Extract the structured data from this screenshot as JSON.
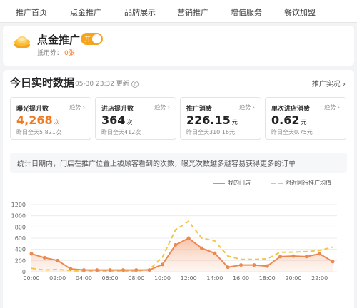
{
  "nav": {
    "items": [
      "推广首页",
      "点金推广",
      "品牌展示",
      "营销推广",
      "增值服务",
      "餐饮加盟"
    ]
  },
  "promo": {
    "title": "点金推广",
    "toggle_label": "开",
    "coupon_label": "抵用券：",
    "coupon_value": "0张"
  },
  "realtime": {
    "title": "今日实时数据",
    "update_time": "05-30 23:32 更新",
    "link": "推广实况 ›"
  },
  "metrics": [
    {
      "label": "曝光提升数",
      "trend": "趋势 ›",
      "value": "4,268",
      "unit": "次",
      "prev": "昨日全天5,821次",
      "highlight": true
    },
    {
      "label": "进店提升数",
      "trend": "趋势 ›",
      "value": "364",
      "unit": "次",
      "prev": "昨日全天412次",
      "highlight": false
    },
    {
      "label": "推广消费",
      "trend": "趋势 ›",
      "value": "226.15",
      "unit": "元",
      "prev": "昨日全天310.16元",
      "highlight": false
    },
    {
      "label": "单次进店消费",
      "trend": "趋势 ›",
      "value": "0.62",
      "unit": "元",
      "prev": "昨日全天0.75元",
      "highlight": false
    }
  ],
  "note": "统计日期内，门店在推广位置上被顾客看到的次数，曝光次数越多越容易获得更多的订单",
  "colors": {
    "accent": "#f07a22",
    "mine": "#ea8a52",
    "avg": "#f6c548"
  },
  "chart_data": {
    "type": "line",
    "x": [
      "00:00",
      "01:00",
      "02:00",
      "03:00",
      "04:00",
      "05:00",
      "06:00",
      "07:00",
      "08:00",
      "09:00",
      "10:00",
      "11:00",
      "12:00",
      "13:00",
      "14:00",
      "15:00",
      "16:00",
      "17:00",
      "18:00",
      "19:00",
      "20:00",
      "21:00",
      "22:00",
      "23:00"
    ],
    "xticks": [
      "00:00",
      "02:00",
      "04:00",
      "06:00",
      "08:00",
      "10:00",
      "12:00",
      "14:00",
      "16:00",
      "18:00",
      "20:00",
      "22:00"
    ],
    "yticks": [
      0,
      200,
      400,
      600,
      800,
      1000,
      1200
    ],
    "ylim": [
      0,
      1200
    ],
    "legend_position": "top-right",
    "series": [
      {
        "name": "我的门店",
        "values": [
          320,
          250,
          200,
          50,
          30,
          30,
          30,
          30,
          30,
          30,
          130,
          480,
          600,
          420,
          330,
          80,
          120,
          120,
          100,
          270,
          280,
          270,
          320,
          180
        ]
      },
      {
        "name": "附近同行推广均值",
        "values": [
          60,
          30,
          40,
          20,
          10,
          10,
          10,
          10,
          10,
          40,
          260,
          750,
          900,
          600,
          550,
          280,
          220,
          220,
          230,
          350,
          350,
          360,
          380,
          440
        ]
      }
    ]
  }
}
